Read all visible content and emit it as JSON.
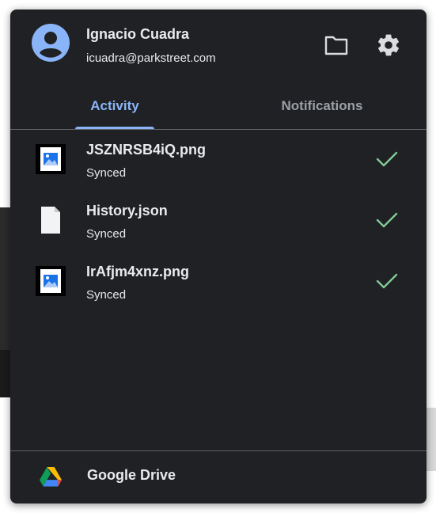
{
  "account": {
    "name": "Ignacio Cuadra",
    "email": "icuadra@parkstreet.com"
  },
  "header_icons": [
    "folder-icon",
    "gear-icon"
  ],
  "tabs": [
    {
      "label": "Activity",
      "active": true
    },
    {
      "label": "Notifications",
      "active": false
    }
  ],
  "files": [
    {
      "name": "JSZNRSB4iQ.png",
      "status": "Synced",
      "icon": "image-file-icon"
    },
    {
      "name": "History.json",
      "status": "Synced",
      "icon": "document-file-icon"
    },
    {
      "name": "IrAfjm4xnz.png",
      "status": "Synced",
      "icon": "image-file-icon"
    }
  ],
  "footer": {
    "label": "Google Drive"
  },
  "colors": {
    "panel_bg": "#202124",
    "accent": "#8ab4f8",
    "check": "#81c995",
    "text": "#e8eaed",
    "muted": "#9aa0a6"
  }
}
